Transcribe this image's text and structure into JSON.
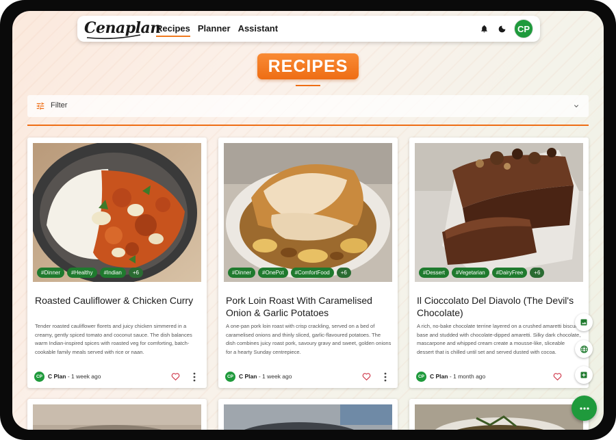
{
  "nav": {
    "logo": "Cenaplan",
    "links": [
      "Recipes",
      "Planner",
      "Assistant"
    ],
    "active": "Recipes",
    "avatar_initials": "CP",
    "icons": [
      "bell-icon",
      "moon-icon"
    ]
  },
  "page": {
    "title": "RECIPES",
    "filter_label": "Filter"
  },
  "colors": {
    "accent": "#ee6d14",
    "brand_green": "#1f9a3c",
    "tag_green": "#1f7a2e"
  },
  "recipes": [
    {
      "title": "Roasted Cauliflower & Chicken Curry",
      "description": "Tender roasted cauliflower florets and juicy chicken simmered in a creamy, gently spiced tomato and coconut sauce. The dish balances warm Indian-inspired spices with roasted veg for comforting, batch-cookable family meals served with rice or naan.",
      "tags": [
        "#Dinner",
        "#Healthy",
        "#Indian"
      ],
      "more_tags": "+6",
      "author_initials": "CP",
      "author": "C Plan",
      "time": " - 1 week ago"
    },
    {
      "title": "Pork Loin Roast With Caramelised Onion & Garlic Potatoes",
      "description": "A one-pan pork loin roast with crisp crackling, served on a bed of caramelised onions and thinly sliced, garlic-flavoured potatoes. The dish combines juicy roast pork, savoury gravy and sweet, golden onions for a hearty Sunday centrepiece.",
      "tags": [
        "#Dinner",
        "#OnePot",
        "#ComfortFood"
      ],
      "more_tags": "+6",
      "author_initials": "CP",
      "author": "C Plan",
      "time": " - 1 week ago"
    },
    {
      "title": "Il Cioccolato Del Diavolo (The Devil's Chocolate)",
      "description": "A rich, no-bake chocolate terrine layered on a crushed amaretti biscuit base and studded with chocolate-dipped amaretti. Silky dark chocolate, mascarpone and whipped cream create a mousse-like, sliceable dessert that is chilled until set and served dusted with cocoa.",
      "tags": [
        "#Dessert",
        "#Vegetarian",
        "#DairyFree"
      ],
      "more_tags": "+6",
      "author_initials": "CP",
      "author": "C Plan",
      "time": " - 1 month ago"
    }
  ],
  "side_actions": [
    "image-icon",
    "globe-icon",
    "add-box-icon"
  ],
  "main_fab_icon": "more-horiz-icon"
}
